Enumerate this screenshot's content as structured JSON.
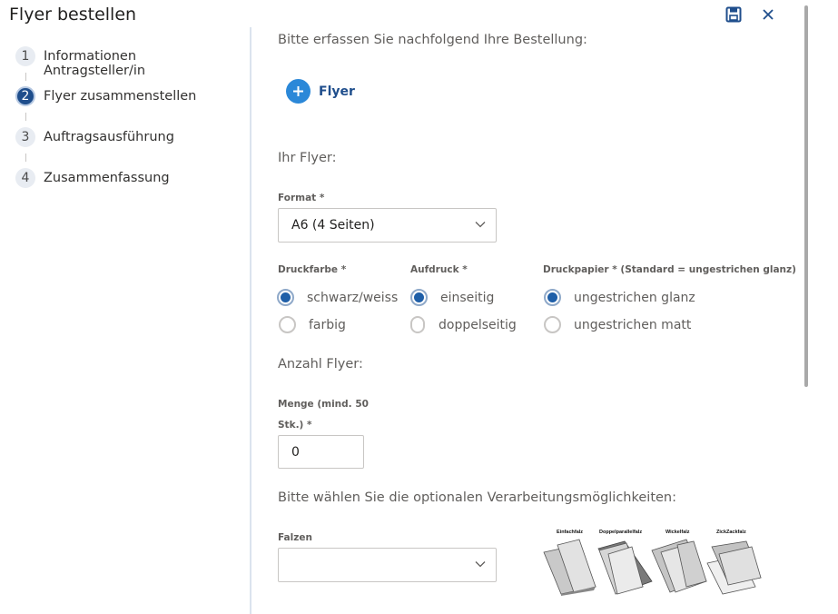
{
  "header": {
    "title": "Flyer bestellen",
    "save_icon": "save-icon",
    "close_icon": "close-icon"
  },
  "steps": [
    {
      "num": "1",
      "label": "Informationen Antragsteller/in",
      "active": false
    },
    {
      "num": "2",
      "label": "Flyer zusammenstellen",
      "active": true
    },
    {
      "num": "3",
      "label": "Auftragsausführung",
      "active": false
    },
    {
      "num": "4",
      "label": "Zusammenfassung",
      "active": false
    }
  ],
  "main": {
    "intro": "Bitte erfassen Sie nachfolgend Ihre Bestellung:",
    "add_button": "Flyer",
    "your_flyer": "Ihr Flyer:",
    "format": {
      "label": "Format *",
      "value": "A6 (4 Seiten)"
    },
    "druckfarbe": {
      "label": "Druckfarbe *",
      "options": [
        "schwarz/weiss",
        "farbig"
      ],
      "selected": "schwarz/weiss"
    },
    "aufdruck": {
      "label": "Aufdruck *",
      "options": [
        "einseitig",
        "doppelseitig"
      ],
      "selected": "einseitig"
    },
    "druckpapier": {
      "label": "Druckpapier * (Standard = ungestrichen glanz)",
      "options": [
        "ungestrichen glanz",
        "ungestrichen matt"
      ],
      "selected": "ungestrichen glanz"
    },
    "anzahl_title": "Anzahl Flyer:",
    "menge": {
      "label_line1": "Menge (mind. 50",
      "label_line2": "Stk.) *",
      "value": "0"
    },
    "processing_title": "Bitte wählen Sie die optionalen Verarbeitungsmöglichkeiten:",
    "falzen": {
      "label": "Falzen",
      "value": ""
    },
    "fold_types": [
      "Einfachfalz",
      "Doppelparallelfalz",
      "Wickelfalz",
      "ZickZackfalz"
    ]
  },
  "colors": {
    "accent": "#2b88d8",
    "active_step": "#1f4e8c",
    "radio_selected": "#1f5fa8"
  }
}
